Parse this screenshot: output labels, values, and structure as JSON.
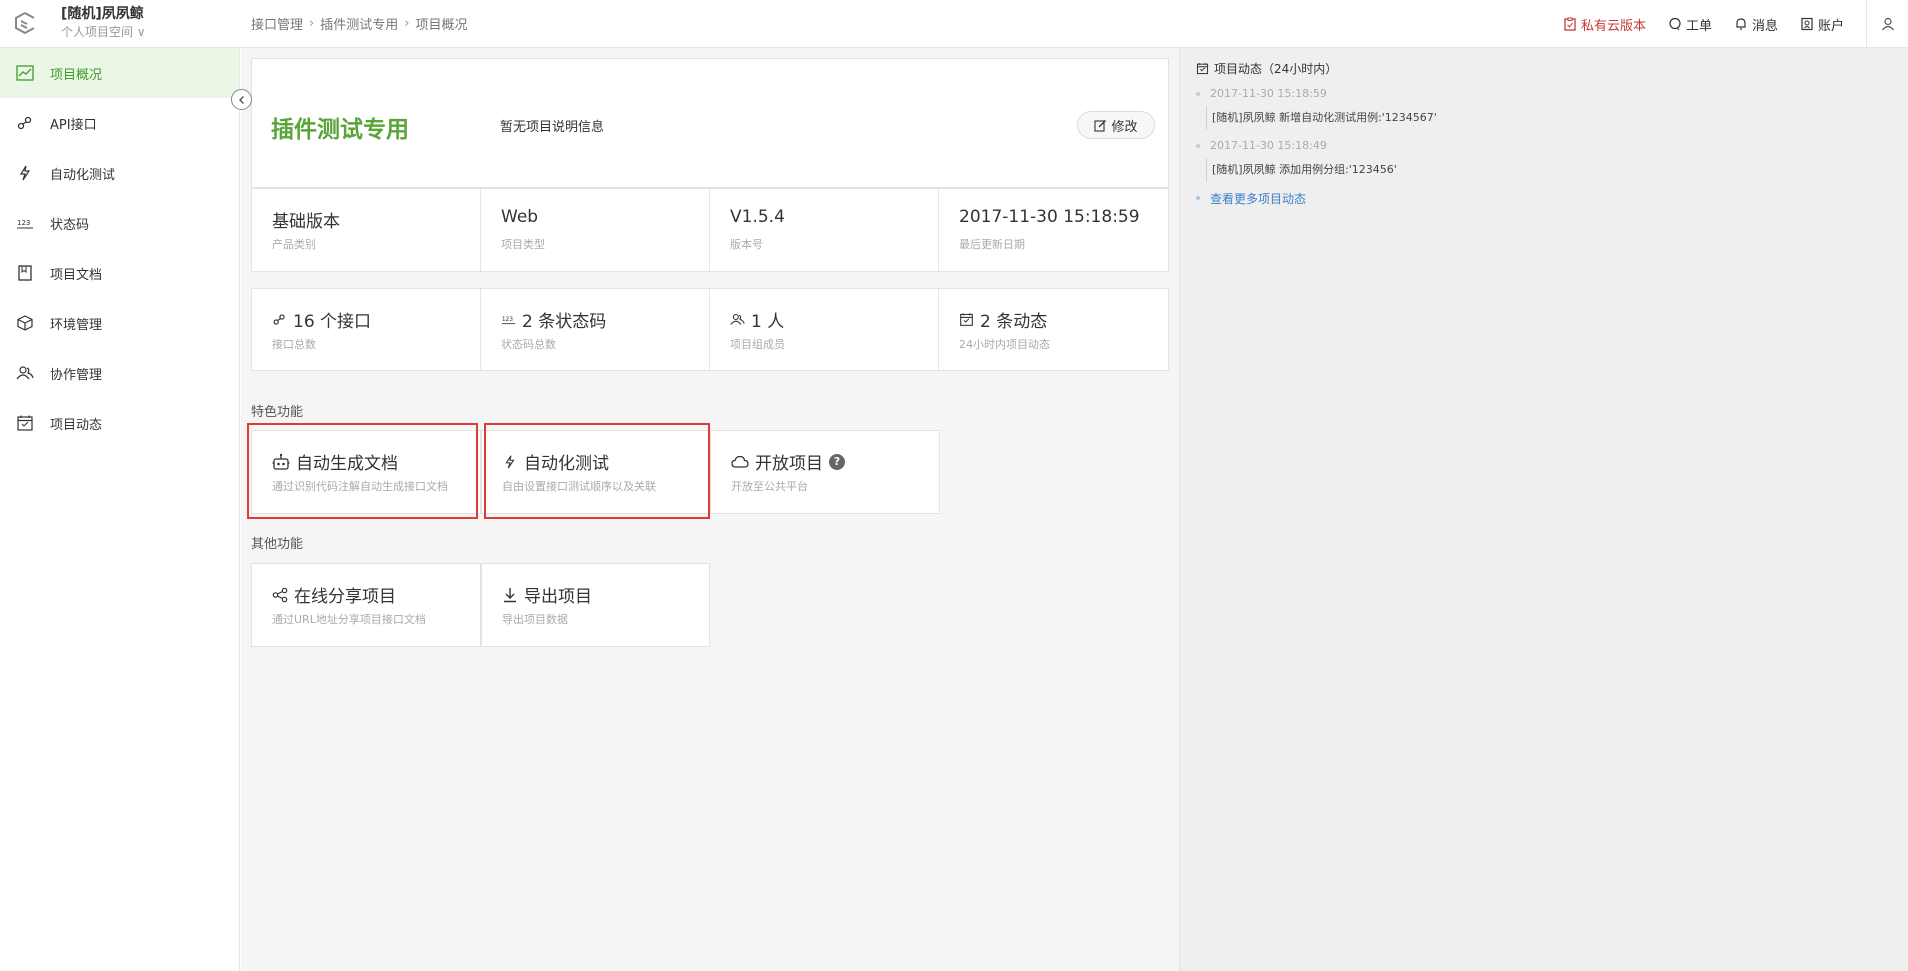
{
  "header": {
    "workspace_name": "[随机]夙夙鲸",
    "workspace_sub": "个人项目空间",
    "breadcrumb": [
      "接口管理",
      "插件测试专用",
      "项目概况"
    ],
    "nav": {
      "private_cloud": "私有云版本",
      "ticket": "工单",
      "message": "消息",
      "account": "账户"
    }
  },
  "sidebar": {
    "items": [
      {
        "label": "项目概况",
        "icon": "chart-icon"
      },
      {
        "label": "API接口",
        "icon": "link-icon"
      },
      {
        "label": "自动化测试",
        "icon": "bolt-icon"
      },
      {
        "label": "状态码",
        "icon": "number-icon"
      },
      {
        "label": "项目文档",
        "icon": "doc-icon"
      },
      {
        "label": "环境管理",
        "icon": "cube-icon"
      },
      {
        "label": "协作管理",
        "icon": "users-icon"
      },
      {
        "label": "项目动态",
        "icon": "calendar-icon"
      }
    ]
  },
  "project": {
    "title": "插件测试专用",
    "description": "暂无项目说明信息",
    "edit_label": "修改"
  },
  "info": [
    {
      "value": "基础版本",
      "label": "产品类别"
    },
    {
      "value": "Web",
      "label": "项目类型"
    },
    {
      "value": "V1.5.4",
      "label": "版本号"
    },
    {
      "value": "2017-11-30 15:18:59",
      "label": "最后更新日期"
    }
  ],
  "stats": [
    {
      "value": "16 个接口",
      "label": "接口总数",
      "icon": "link-icon"
    },
    {
      "value": "2 条状态码",
      "label": "状态码总数",
      "icon": "number-icon"
    },
    {
      "value": "1 人",
      "label": "项目组成员",
      "icon": "users-icon"
    },
    {
      "value": "2 条动态",
      "label": "24小时内项目动态",
      "icon": "calendar-check-icon"
    }
  ],
  "featured": {
    "title": "特色功能",
    "items": [
      {
        "value": "自动生成文档",
        "label": "通过识别代码注解自动生成接口文档",
        "icon": "robot-icon"
      },
      {
        "value": "自动化测试",
        "label": "自由设置接口测试顺序以及关联",
        "icon": "bolt-icon"
      },
      {
        "value": "开放项目",
        "label": "开放至公共平台",
        "icon": "cloud-icon"
      }
    ]
  },
  "other": {
    "title": "其他功能",
    "items": [
      {
        "value": "在线分享项目",
        "label": "通过URL地址分享项目接口文档",
        "icon": "share-icon"
      },
      {
        "value": "导出项目",
        "label": "导出项目数据",
        "icon": "download-icon"
      }
    ]
  },
  "activity": {
    "title": "项目动态（24小时内）",
    "entries": [
      {
        "time": "2017-11-30 15:18:59",
        "text": "[随机]夙夙鲸 新增自动化测试用例:'1234567'"
      },
      {
        "time": "2017-11-30 15:18:49",
        "text": "[随机]夙夙鲸 添加用例分组:'123456'"
      }
    ],
    "more": "查看更多项目动态"
  },
  "colors": {
    "accent": "#5aa53a",
    "highlight": "#e03a3a",
    "link": "#3c7fc8"
  }
}
